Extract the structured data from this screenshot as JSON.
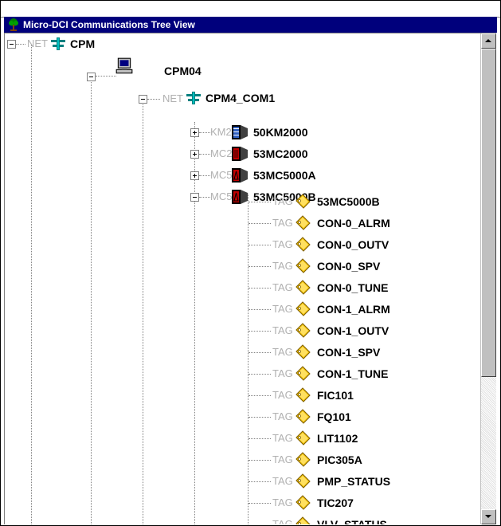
{
  "window": {
    "title": "Micro-DCI Communications Tree View"
  },
  "tree": {
    "root": {
      "prefix": "NET",
      "label": "CPM"
    },
    "cpu": {
      "label": "CPM04"
    },
    "com": {
      "prefix": "NET",
      "label": "CPM4_COM1"
    },
    "devices": [
      {
        "prefix": "KM2",
        "label": "50KM2000",
        "expanded": false
      },
      {
        "prefix": "MC2",
        "label": "53MC2000",
        "expanded": false
      },
      {
        "prefix": "MC5",
        "label": "53MC5000A",
        "expanded": false
      },
      {
        "prefix": "MC5",
        "label": "53MC5000B",
        "expanded": true
      }
    ],
    "tags": [
      {
        "prefix": "TAG",
        "label": "53MC5000B"
      },
      {
        "prefix": "TAG",
        "label": "CON-0_ALRM"
      },
      {
        "prefix": "TAG",
        "label": "CON-0_OUTV"
      },
      {
        "prefix": "TAG",
        "label": "CON-0_SPV"
      },
      {
        "prefix": "TAG",
        "label": "CON-0_TUNE"
      },
      {
        "prefix": "TAG",
        "label": "CON-1_ALRM"
      },
      {
        "prefix": "TAG",
        "label": "CON-1_OUTV"
      },
      {
        "prefix": "TAG",
        "label": "CON-1_SPV"
      },
      {
        "prefix": "TAG",
        "label": "CON-1_TUNE"
      },
      {
        "prefix": "TAG",
        "label": "FIC101"
      },
      {
        "prefix": "TAG",
        "label": "FQ101"
      },
      {
        "prefix": "TAG",
        "label": "LIT1102"
      },
      {
        "prefix": "TAG",
        "label": "PIC305A"
      },
      {
        "prefix": "TAG",
        "label": "PMP_STATUS"
      },
      {
        "prefix": "TAG",
        "label": "TIC207"
      },
      {
        "prefix": "TAG",
        "label": "VLV_STATUS"
      }
    ]
  },
  "colors": {
    "titlebar": "#00007c",
    "tag_icon": "#f0c000",
    "net_icon": "#008080",
    "device_red": "#c00000"
  },
  "icons": {
    "title": "tree-icon",
    "net": "network-icon",
    "cpu": "computer-icon",
    "device": "controller-icon",
    "tag": "tag-icon"
  }
}
